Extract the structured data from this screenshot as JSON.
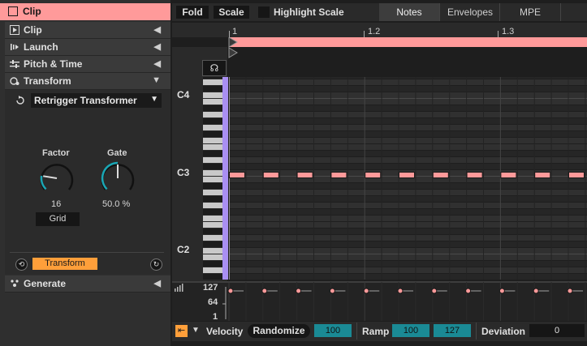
{
  "left_panel": {
    "title": "Clip",
    "sections": [
      {
        "label": "Clip",
        "arrow": "◀"
      },
      {
        "label": "Launch",
        "arrow": "◀"
      },
      {
        "label": "Pitch & Time",
        "arrow": "◀"
      },
      {
        "label": "Transform",
        "arrow": "▼"
      }
    ],
    "transform": {
      "selected": "Retrigger Transformer",
      "factor_label": "Factor",
      "factor_value": "16",
      "factor_fraction": 0.2,
      "gate_label": "Gate",
      "gate_value": "50.0 %",
      "gate_fraction": 0.5,
      "grid_label": "Grid",
      "transform_button": "Transform"
    },
    "generate": {
      "label": "Generate",
      "arrow": "◀"
    }
  },
  "toolbar": {
    "fold": "Fold",
    "scale": "Scale",
    "highlight_scale": "Highlight Scale",
    "tabs": [
      {
        "label": "Notes",
        "active": true
      },
      {
        "label": "Envelopes",
        "active": false
      },
      {
        "label": "MPE",
        "active": false
      }
    ]
  },
  "ruler": {
    "marks": [
      "1",
      "1.2",
      "1.3"
    ]
  },
  "piano": {
    "octaves": [
      "C4",
      "C3",
      "C2"
    ]
  },
  "notes": {
    "count": 11,
    "pitch": "C3",
    "color": "#ff9a9a"
  },
  "velocity": {
    "scale": [
      "127",
      "64",
      "1"
    ],
    "values": [
      127,
      127,
      127,
      127,
      127,
      127,
      127,
      127,
      127,
      127,
      127
    ]
  },
  "bottom": {
    "velocity_label": "Velocity",
    "randomize_label": "Randomize",
    "randomize_value": "100",
    "ramp_label": "Ramp",
    "ramp_start": "100",
    "ramp_end": "127",
    "deviation_label": "Deviation",
    "deviation_value": "0"
  },
  "colors": {
    "accent": "#ff9a9a",
    "orange": "#ff9f3a",
    "teal": "#1a8a95",
    "purple": "#a98ff2"
  }
}
